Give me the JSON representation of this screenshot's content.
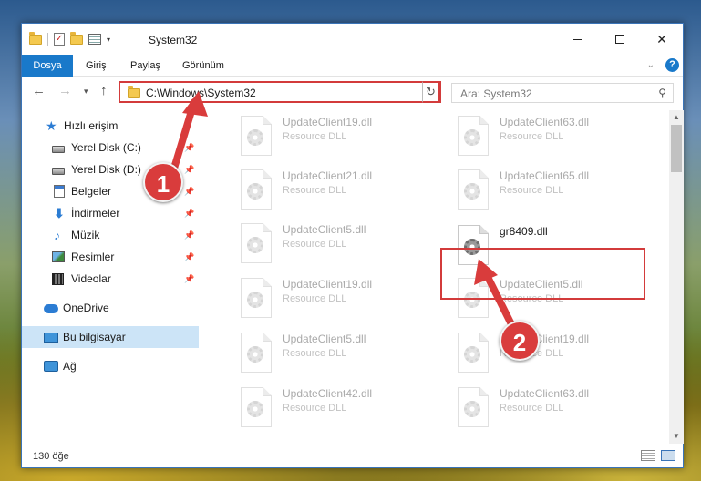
{
  "window": {
    "title": "System32",
    "controls": {
      "minimize": "minimize",
      "maximize": "maximize",
      "close": "close"
    }
  },
  "ribbon": {
    "tabs": [
      "Dosya",
      "Giriş",
      "Paylaş",
      "Görünüm"
    ],
    "help": "?"
  },
  "nav": {
    "address": "C:\\Windows\\System32",
    "search_placeholder": "Ara: System32"
  },
  "sidebar": {
    "quick_access": "Hızlı erişim",
    "items": [
      {
        "label": "Yerel Disk (C:)",
        "icon": "disk-icon",
        "pinned": true
      },
      {
        "label": "Yerel Disk (D:)",
        "icon": "disk-icon",
        "pinned": true
      },
      {
        "label": "Belgeler",
        "icon": "documents-icon",
        "pinned": true
      },
      {
        "label": "İndirmeler",
        "icon": "download-icon",
        "pinned": true
      },
      {
        "label": "Müzik",
        "icon": "music-icon",
        "pinned": true
      },
      {
        "label": "Resimler",
        "icon": "pictures-icon",
        "pinned": true
      },
      {
        "label": "Videolar",
        "icon": "videos-icon",
        "pinned": true
      }
    ],
    "onedrive": "OneDrive",
    "this_pc": "Bu bilgisayar",
    "network": "Ağ"
  },
  "files": {
    "left": [
      {
        "name": "UpdateClient19.dll",
        "type": "Resource DLL"
      },
      {
        "name": "UpdateClient21.dll",
        "type": "Resource DLL"
      },
      {
        "name": "UpdateClient5.dll",
        "type": "Resource DLL"
      },
      {
        "name": "UpdateClient19.dll",
        "type": "Resource DLL"
      },
      {
        "name": "UpdateClient5.dll",
        "type": "Resource DLL"
      },
      {
        "name": "UpdateClient42.dll",
        "type": "Resource DLL"
      }
    ],
    "right": [
      {
        "name": "UpdateClient63.dll",
        "type": "Resource DLL"
      },
      {
        "name": "UpdateClient65.dll",
        "type": "Resource DLL"
      },
      {
        "name": "gr8409.dll",
        "type": ""
      },
      {
        "name": "UpdateClient5.dll",
        "type": "Resource DLL"
      },
      {
        "name": "UpdateClient19.dll",
        "type": "Resource DLL"
      },
      {
        "name": "UpdateClient63.dll",
        "type": "Resource DLL"
      }
    ]
  },
  "status": {
    "count": "130 öğe"
  },
  "callouts": [
    "1",
    "2"
  ],
  "colors": {
    "accent": "#1979ca",
    "highlight": "#d33b3b",
    "selected": "#cce4f7"
  }
}
